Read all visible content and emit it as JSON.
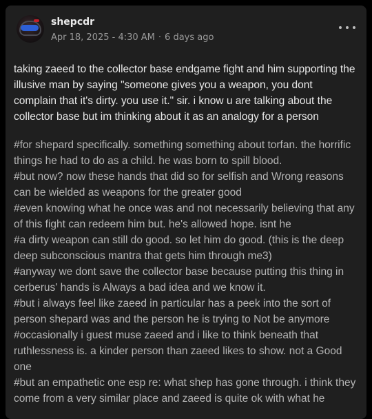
{
  "post": {
    "author": "shepcdr",
    "date": "Apr 18, 2025 - 4:30 AM",
    "separator": "·",
    "relative_time": "6 days ago",
    "more_icon": "more-horizontal-icon",
    "body": "taking zaeed to the collector base endgame fight and him supporting the illusive man by saying \"someone gives you a weapon, you dont complain that it's dirty. you use it.\" sir. i know u are talking about the collector base but im thinking about it as an analogy for a person",
    "tags": [
      "#for shepard specifically. something something about torfan. the horrific things he had to do as a child. he was born to spill blood.",
      "#but now? now these hands that did so for selfish and Wrong reasons can be wielded as weapons for the greater good",
      "#even knowing what he once was and not necessarily believing that any of this fight can redeem him but. he's allowed hope. isnt he",
      "#a dirty weapon can still do good. so let him do good. (this is the deep deep subconscious mantra that gets him through me3)",
      "#anyway we dont save the collector base because putting this thing in cerberus' hands is Always a bad idea and we know it.",
      "#but i always feel like zaeed in particular has a peek into the sort of person shepard was and the person he is trying to Not be anymore",
      "#occasionally i guest muse zaeed and i like to think beneath that ruthlessness is. a kinder person than zaeed likes to show. not a Good one",
      "#but an empathetic one esp re: what shep has gone through. i think they come from a very similar place and zaeed is quite ok with what he"
    ]
  },
  "colors": {
    "page_background": "#000000",
    "card_background": "#1f1f1f",
    "primary_text": "#e9e9e9",
    "secondary_text": "#9a9a9a",
    "tag_text": "#b5b5b5",
    "avatar_visor": "#2d5fd6"
  }
}
